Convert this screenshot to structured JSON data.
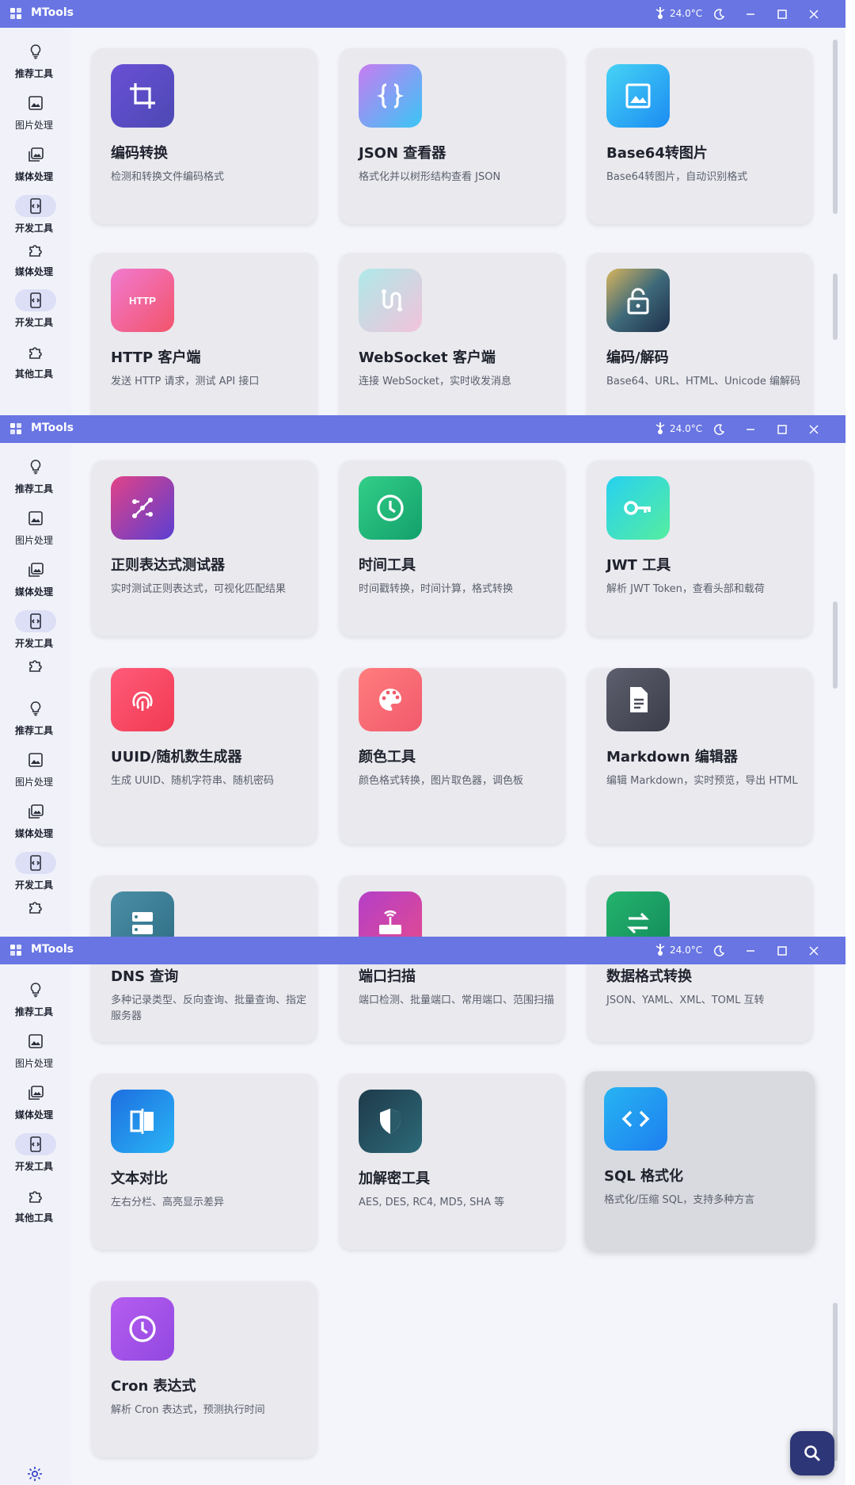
{
  "app": {
    "title": "MTools",
    "temperature": "24.0°C"
  },
  "nav": {
    "recommend": "推荐工具",
    "image": "图片处理",
    "media": "媒体处理",
    "dev": "开发工具",
    "other": "其他工具"
  },
  "tools": {
    "encoding": {
      "title": "编码转换",
      "desc": "检测和转换文件编码格式"
    },
    "json": {
      "title": "JSON 查看器",
      "desc": "格式化并以树形结构查看 JSON"
    },
    "base64img": {
      "title": "Base64转图片",
      "desc": "Base64转图片，自动识别格式"
    },
    "http": {
      "title": "HTTP 客户端",
      "desc": "发送 HTTP 请求，测试 API 接口"
    },
    "websocket": {
      "title": "WebSocket 客户端",
      "desc": "连接 WebSocket，实时收发消息"
    },
    "codec": {
      "title": "编码/解码",
      "desc": "Base64、URL、HTML、Unicode 编解码"
    },
    "regex": {
      "title": "正则表达式测试器",
      "desc": "实时测试正则表达式，可视化匹配结果"
    },
    "time": {
      "title": "时间工具",
      "desc": "时间戳转换，时间计算，格式转换"
    },
    "jwt": {
      "title": "JWT 工具",
      "desc": "解析 JWT Token，查看头部和载荷"
    },
    "uuid": {
      "title": "UUID/随机数生成器",
      "desc": "生成 UUID、随机字符串、随机密码"
    },
    "color": {
      "title": "颜色工具",
      "desc": "颜色格式转换，图片取色器，调色板"
    },
    "markdown": {
      "title": "Markdown 编辑器",
      "desc": "编辑 Markdown，实时预览，导出 HTML"
    },
    "dns": {
      "title": "DNS 查询",
      "desc": "多种记录类型、反向查询、批量查询、指定服务器"
    },
    "port": {
      "title": "端口扫描",
      "desc": "端口检测、批量端口、常用端口、范围扫描"
    },
    "dataformat": {
      "title": "数据格式转换",
      "desc": "JSON、YAML、XML、TOML 互转"
    },
    "textdiff": {
      "title": "文本对比",
      "desc": "左右分栏、高亮显示差异"
    },
    "crypto": {
      "title": "加解密工具",
      "desc": "AES, DES, RC4, MD5, SHA 等"
    },
    "sql": {
      "title": "SQL 格式化",
      "desc": "格式化/压缩 SQL，支持多种方言"
    },
    "cron": {
      "title": "Cron 表达式",
      "desc": "解析 Cron 表达式，预测执行时间"
    }
  },
  "colors": {
    "titlebar": "#6875e2",
    "sidebar": "#f1f2f9",
    "active_pill": "#dcdff6",
    "card": "#e9e9ee"
  },
  "icons": {
    "temperature": "thermometer-icon",
    "theme": "moon-icon",
    "minimize": "minimize-icon",
    "maximize": "maximize-icon",
    "close": "close-icon",
    "search": "search-icon",
    "settings": "gear-icon"
  }
}
